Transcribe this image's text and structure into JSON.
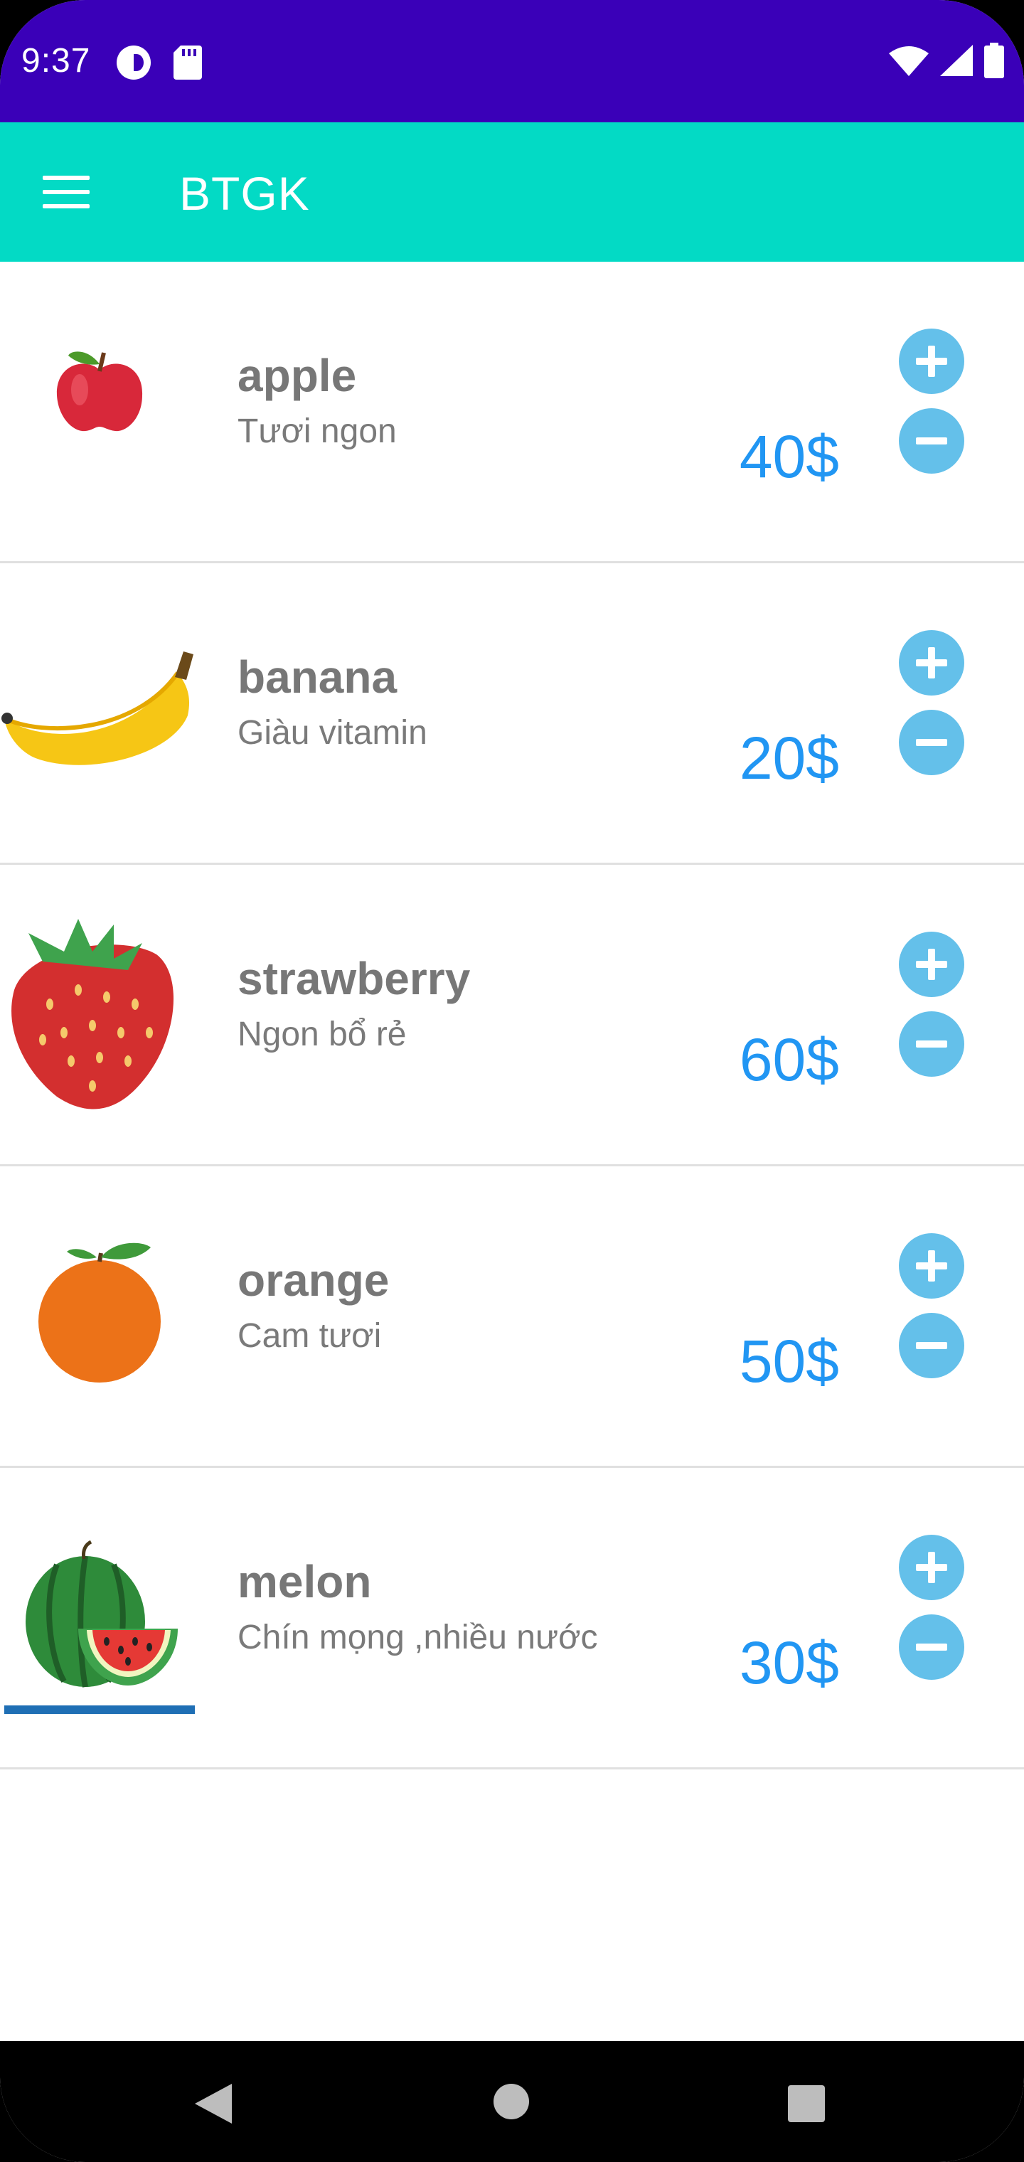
{
  "status_bar": {
    "time": "9:37",
    "left_icons": [
      "sync-icon",
      "sd-card-icon"
    ],
    "right_icons": [
      "wifi-icon",
      "cellular-signal-icon",
      "battery-icon"
    ],
    "background": "#3a00b8"
  },
  "app_bar": {
    "title": "BTGK",
    "menu_icon": "hamburger-menu-icon",
    "background": "#03dac5"
  },
  "items": [
    {
      "name": "apple",
      "description": "Tươi ngon",
      "price": "40$",
      "image": "apple-image"
    },
    {
      "name": "banana",
      "description": "Giàu vitamin",
      "price": "20$",
      "image": "banana-image"
    },
    {
      "name": "strawberry",
      "description": "Ngon bổ rẻ",
      "price": "60$",
      "image": "strawberry-image"
    },
    {
      "name": "orange",
      "description": "Cam tươi",
      "price": "50$",
      "image": "orange-image"
    },
    {
      "name": "melon",
      "description": "Chín mọng ,nhiều nước",
      "price": "30$",
      "image": "watermelon-image"
    }
  ],
  "colors": {
    "price": "#2196f3",
    "round_button": "#64c0ea",
    "name_text": "#777777"
  },
  "nav_bar": {
    "back_icon": "back-triangle-icon",
    "home_icon": "home-circle-icon",
    "recents_icon": "recents-square-icon"
  }
}
